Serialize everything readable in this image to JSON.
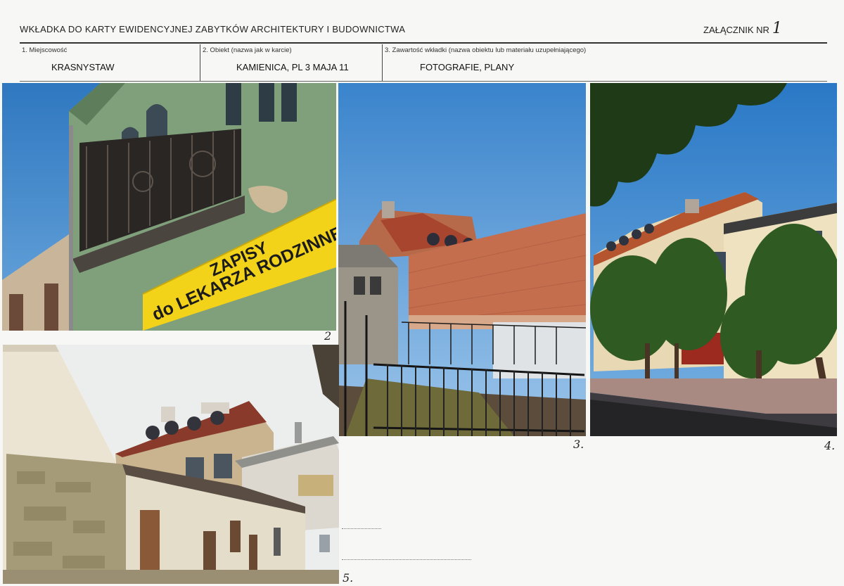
{
  "header": {
    "title": "WKŁADKA DO KARTY EWIDENCYJNEJ ZABYTKÓW  ARCHITEKTURY I BUDOWNICTWA",
    "annex_label": "ZAŁĄCZNIK NR",
    "annex_number": "1"
  },
  "fields": {
    "location": {
      "label": "1. Miejscowość",
      "value": "KRASNYSTAW"
    },
    "object": {
      "label": "2. Obiekt (nazwa jak w karcie)",
      "value": "KAMIENICA, PL 3 MAJA 11"
    },
    "contents": {
      "label": "3. Zawartość wkładki (nazwa obiektu lub materiału uzupełniającego)",
      "value": "FOTOGRAFIE, PLANY"
    }
  },
  "photos": {
    "photo_2": {
      "number": "2",
      "sign_line1": "ZAPISY",
      "sign_line2": "do LEKARZA RODZINNEGO"
    },
    "photo_3": {
      "number": "3."
    },
    "photo_4": {
      "number": "4."
    },
    "photo_5": {
      "number": "5."
    }
  },
  "colors": {
    "sky": "#3d86c9",
    "facade_green": "#7fa07a",
    "sign_yellow": "#f3d21a",
    "brick_wall": "#c46e4e",
    "roof_red": "#a7452e",
    "tree_green": "#2f5a22",
    "plaster_cream": "#e8d9b4"
  }
}
